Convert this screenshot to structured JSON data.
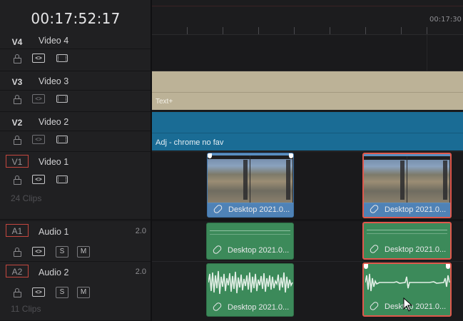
{
  "header": {
    "timecode": "00:17:52:17"
  },
  "ruler": {
    "label": "00:17:30"
  },
  "tracks": {
    "v4": {
      "id": "V4",
      "name": "Video 4"
    },
    "v3": {
      "id": "V3",
      "name": "Video 3"
    },
    "v2": {
      "id": "V2",
      "name": "Video 2"
    },
    "v1": {
      "id": "V1",
      "name": "Video 1",
      "clip_count": "24 Clips"
    },
    "a1": {
      "id": "A1",
      "name": "Audio 1",
      "level": "2.0"
    },
    "a2": {
      "id": "A2",
      "name": "Audio 2",
      "level": "2.0",
      "clip_count": "11 Clips"
    }
  },
  "buttons": {
    "solo": "S",
    "mute": "M"
  },
  "icons": {
    "lock": "lock-icon",
    "auto_select": "auto-select-icon",
    "enable": "film-icon",
    "link": "link-icon"
  },
  "clips": {
    "v3_title": "Text+",
    "v2_title": "Adj - chrome no fav",
    "v1_a": "Desktop 2021.0...",
    "v1_b": "Desktop 2021.0...",
    "a1_a": "Desktop 2021.0...",
    "a1_b": "Desktop 2021.0...",
    "a2_a": "Desktop 2021.0...",
    "a2_b": "Desktop 2021.0..."
  },
  "colors": {
    "video_clip": "#5a8ec0",
    "audio_clip": "#3c8a5a",
    "title_clip": "#bcb297",
    "adjustment_clip": "#1a6c95",
    "selection": "#e0584c"
  }
}
